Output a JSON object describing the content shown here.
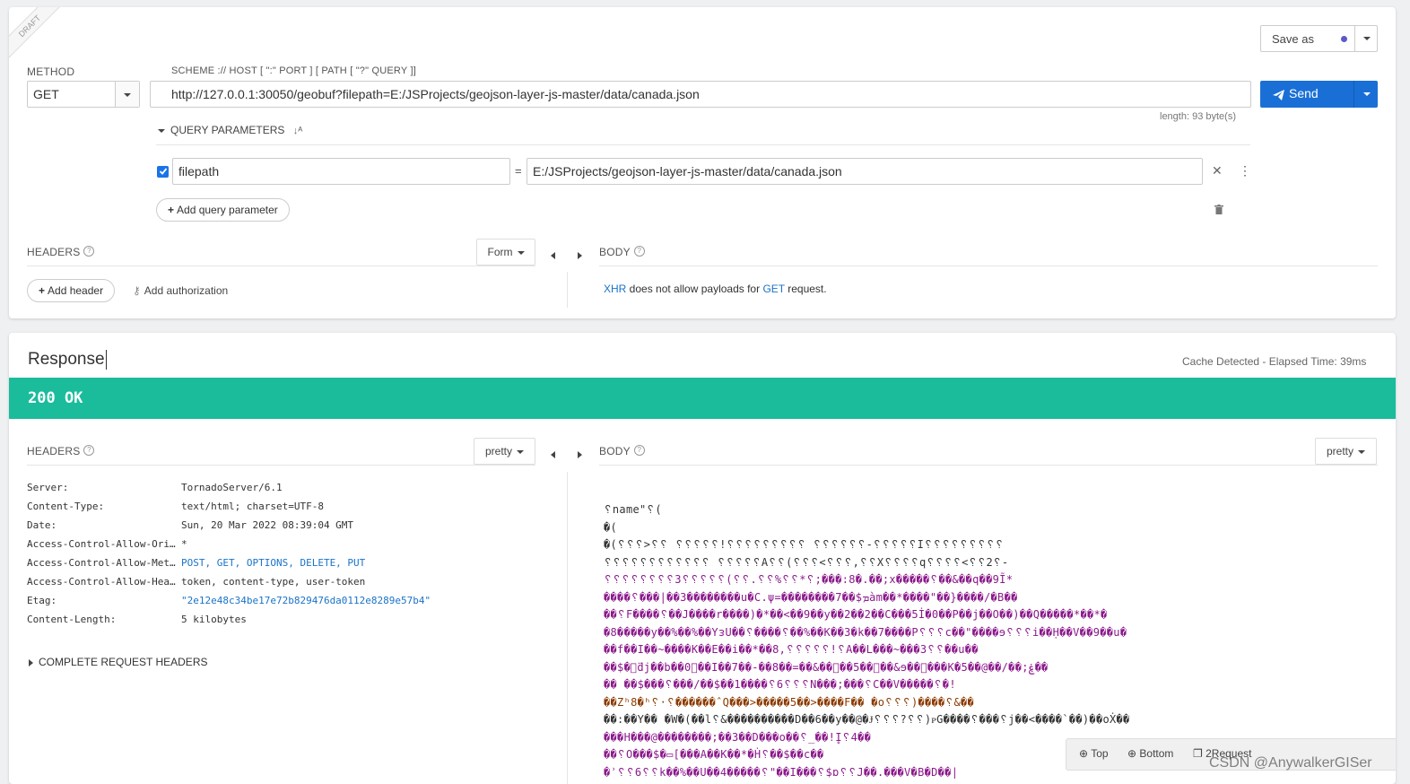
{
  "request": {
    "draft_label": "DRAFT",
    "save_as_label": "Save as",
    "method_label": "METHOD",
    "method_value": "GET",
    "url_hint": "SCHEME :// HOST [ \":\" PORT ] [ PATH [ \"?\" QUERY ]]",
    "url_value": "http://127.0.0.1:30050/geobuf?filepath=E:/JSProjects/geojson-layer-js-master/data/canada.json",
    "send_label": "Send",
    "length_text": "length: 93 byte(s)",
    "query_params_label": "QUERY PARAMETERS",
    "param_name": "filepath",
    "param_eq": "=",
    "param_value": "E:/JSProjects/geojson-layer-js-master/data/canada.json",
    "add_query_label": "Add query parameter",
    "headers_label": "HEADERS",
    "form_label": "Form",
    "body_label": "BODY",
    "add_header_label": "Add header",
    "add_auth_label": "Add authorization",
    "body_msg_xhr": "XHR",
    "body_msg_mid": " does not allow payloads for ",
    "body_msg_get": "GET",
    "body_msg_end": " request."
  },
  "response": {
    "title": "Response",
    "meta": "Cache Detected - Elapsed Time: 39ms",
    "status": "200 OK",
    "status_color": "#1abc9c",
    "headers_label": "HEADERS",
    "pretty_label": "pretty",
    "body_label": "BODY",
    "complete_headers_label": "COMPLETE REQUEST HEADERS",
    "headers": [
      {
        "key": "Server:",
        "value": "TornadoServer/6.1"
      },
      {
        "key": "Content-Type:",
        "value": "text/html; charset=UTF-8"
      },
      {
        "key": "Date:",
        "value": "Sun, 20 Mar 2022 08:39:04 GMT"
      },
      {
        "key": "Access-Control-Allow-Ori…",
        "value": "*"
      },
      {
        "key": "Access-Control-Allow-Met…",
        "value": "POST, GET, OPTIONS, DELETE, PUT"
      },
      {
        "key": "Access-Control-Allow-Hea…",
        "value": "token, content-type, user-token"
      },
      {
        "key": "Etag:",
        "value": "\"2e12e48c34be17e72b829476da0112e8289e57b4\""
      },
      {
        "key": "Content-Length:",
        "value": "5 kilobytes"
      }
    ],
    "body_lines": [
      "␦name\"␦(",
      "�(",
      "�(␦␦␦>␦␦       ␦␦␦␦␦!␦␦␦␦␦␦␦␦␦ ␦␦␦␦␦␦-␦␦␦␦␦I␦␦␦␦␦␦␦␦␦",
      "␦␦␦␦␦␦␦␦␦␦␦␦    ␦␦␦␦␦A␦␦(␦␦␦<␦␦␦,␦␦X␦␦␦␦q␦␦␦␦<␦␦2␦-",
      "␦␦␦␦␦␦␦␦3␦␦␦␦␦(␦␦.␦␦%␦␦*␦;���:8�.��;x�����␦��&��q��9Ĩ*",
      "����␦���|��3��������u�C.ψ=��������7��$ܡàm��*����\"��}����/�B��",
      "��␦F����␦��J����r����)�*��<��9��y��2��2��C���5İ�0��P��j��O��)��Q�����*��*�",
      "�8�����y��%��%��YᴈU��␦����␦��%��K��3�k��7����P␦␦␦c��\"����ɘ␦␦␦i��Ḥ��V��9��u�",
      "��f��I��~����K��E��i��*��8,␦␦␦␦␦!␦A��L���~���3␦␦��u��",
      "��$�ͨ̈dj��b��0␦��I��7��-��8��=��&��␦��5��␦��&ɘ��␦���K�5��@��/��;ۼ��",
      "��  ��$���␦���/��$��1����␦6␦␦␦N���;���␦C��V�����␦�!",
      "��Zʰ8�ʰ␦·␦������ˆQ���>�����5��>����F��  �o␦␦␦)����␦&��",
      "��:��Y��    �W�(��l␦&����������D��6��y��@�Ɉ␦␦␦?␦␦)ᴘG����␦���␦j��<����`��)��oẊ��",
      "���H���@��������;��3��D���o��␦_��!I̥␦4��",
      "��␦O���$�▭[���A��K��*�Ḣ␦��$��c��",
      "�ʾ␦␦6␦␦k��%��U��4�����␦\"��I���␦$ɒ␦␦J��.���V�B�D��|"
    ],
    "body_colors": [
      "#333333",
      "#333333",
      "#333333",
      "#333333",
      "#8b1a8b",
      "#8b1a8b",
      "#8b1a8b",
      "#8b1a8b",
      "#8b1a8b",
      "#8b1a8b",
      "#8b1a8b",
      "#8b3a00",
      "#333333",
      "#8b1a8b",
      "#8b1a8b",
      "#8b1a8b"
    ]
  },
  "footer": {
    "top_label": "Top",
    "bottom_label": "Bottom",
    "request_label": "2Request",
    "watermark": "CSDN @AnywalkerGISer"
  }
}
